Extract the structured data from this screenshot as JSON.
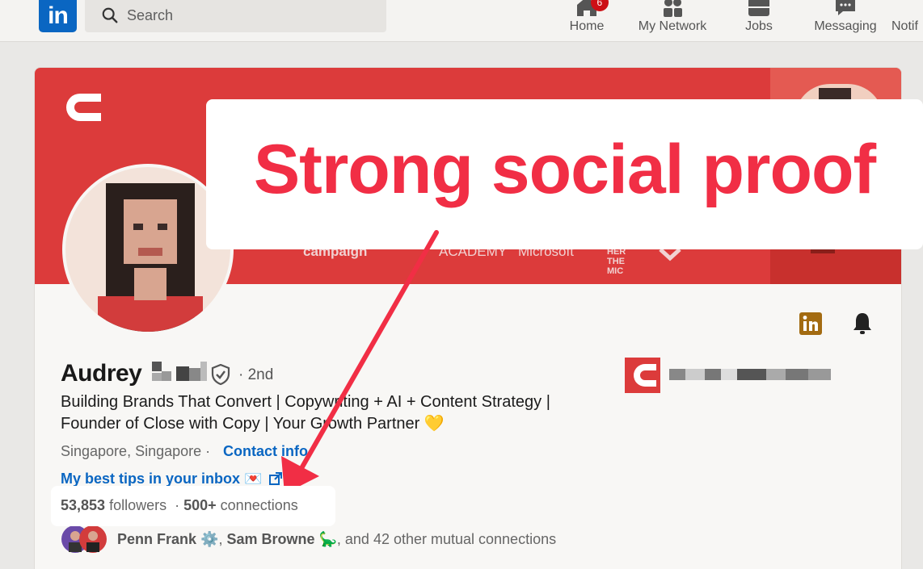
{
  "nav": {
    "search_placeholder": "Search",
    "items": [
      {
        "label": "Home",
        "icon": "home-icon",
        "badge": "6"
      },
      {
        "label": "My Network",
        "icon": "network-icon"
      },
      {
        "label": "Jobs",
        "icon": "briefcase-icon"
      },
      {
        "label": "Messaging",
        "icon": "messaging-icon"
      },
      {
        "label": "Notif",
        "icon": "bell-icon"
      }
    ]
  },
  "banner": {
    "logos": [
      "campaign",
      "ACADEMY",
      "Microsoft",
      "HER THE MIC"
    ]
  },
  "profile": {
    "first_name": "Audrey",
    "degree": "· 2nd",
    "headline": "Building Brands That Convert | Copywriting + AI + Content Strategy | Founder of Close with Copy | Your Growth Partner 💛",
    "location": "Singapore, Singapore ·",
    "contact": "Contact info",
    "tips_link": "My best tips in your inbox 💌",
    "followers_count": "53,853",
    "followers_label": "followers",
    "connections_count": "500+",
    "connections_label": "connections",
    "mutual_1": "Penn Frank",
    "mutual_2": "Sam Browne",
    "mutual_rest": ", and 42 other mutual connections"
  },
  "annotation": {
    "callout": "Strong social proof"
  },
  "colors": {
    "brand": "#0a66c2",
    "banner": "#dc3b3b",
    "annotation": "#f12e45"
  }
}
